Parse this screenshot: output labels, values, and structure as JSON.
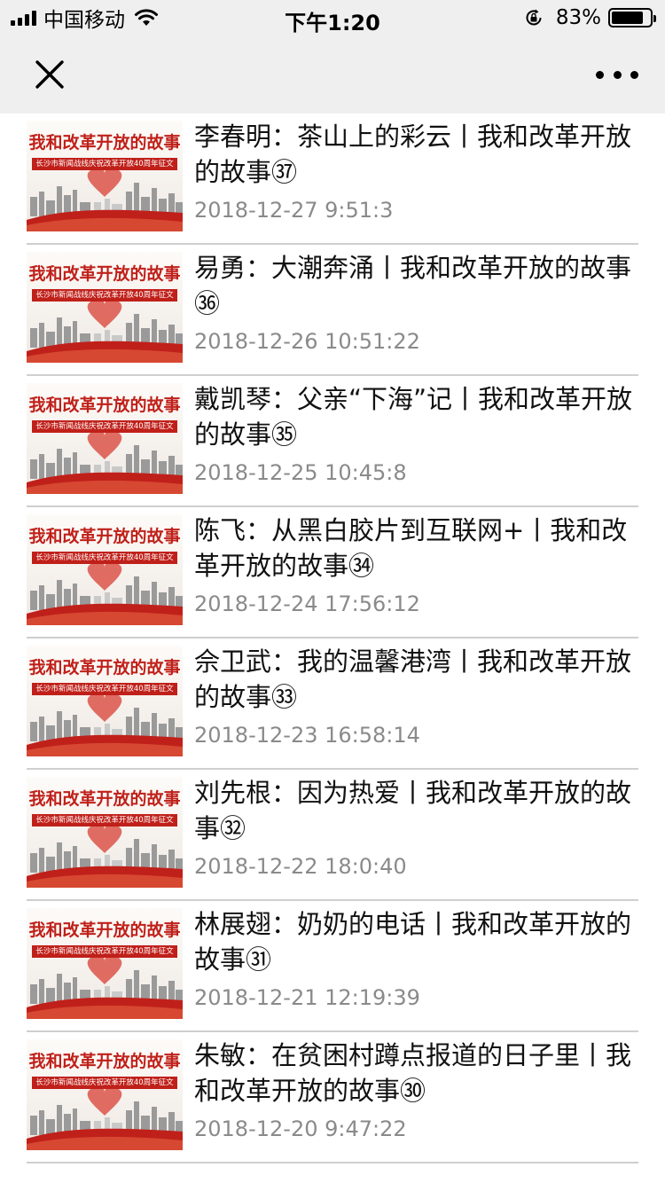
{
  "status": {
    "carrier": "中国移动",
    "time": "下午1:20",
    "battery": "83%",
    "battery_level": 0.83
  },
  "icons": {
    "close": "close-icon",
    "more": "more-icon",
    "signal": "signal-icon",
    "wifi": "wifi-icon",
    "lock": "orientation-lock-icon",
    "battery": "battery-icon"
  },
  "thumbnail": {
    "title": "我和改革开放的故事",
    "subtitle": "长沙市新闻战线庆祝改革开放40周年征文",
    "accent": "#c0201a"
  },
  "articles": [
    {
      "title": "李春明：茶山上的彩云丨我和改革开放的故事㊲",
      "date": "2018-12-27 9:51:3"
    },
    {
      "title": "易勇：大潮奔涌丨我和改革开放的故事㊱",
      "date": "2018-12-26 10:51:22"
    },
    {
      "title": "戴凯琴：父亲“下海”记丨我和改革开放的故事㉟",
      "date": "2018-12-25 10:45:8"
    },
    {
      "title": "陈飞：从黑白胶片到互联网+丨我和改革开放的故事㉞",
      "date": "2018-12-24 17:56:12"
    },
    {
      "title": "佘卫武：我的温馨港湾丨我和改革开放的故事㉝",
      "date": "2018-12-23 16:58:14"
    },
    {
      "title": "刘先根：因为热爱丨我和改革开放的故事㉜",
      "date": "2018-12-22 18:0:40"
    },
    {
      "title": "林展翅：奶奶的电话丨我和改革开放的故事㉛",
      "date": "2018-12-21 12:19:39"
    },
    {
      "title": "朱敏：在贫困村蹲点报道的日子里丨我和改革开放的故事㉚",
      "date": "2018-12-20 9:47:22"
    }
  ]
}
